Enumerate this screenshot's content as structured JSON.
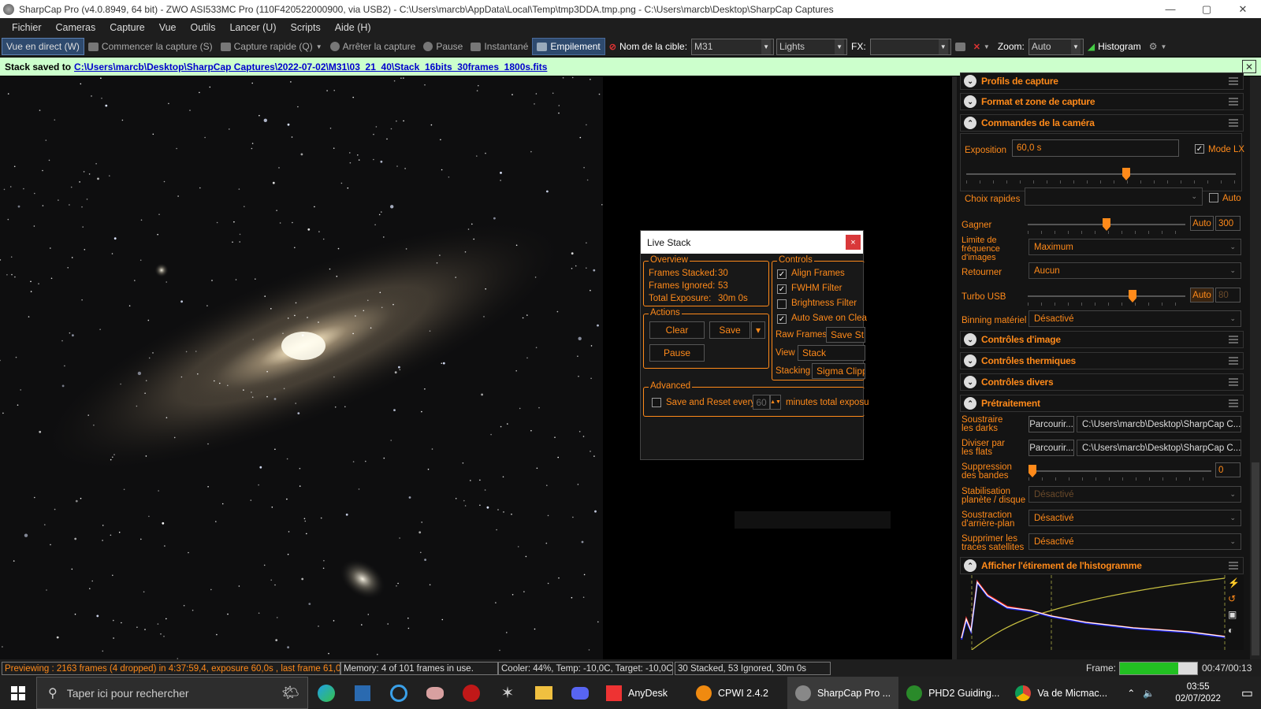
{
  "title_bar": {
    "title": "SharpCap Pro (v4.0.8949, 64 bit) - ZWO ASI533MC Pro (110F420522000900, via USB2) - C:\\Users\\marcb\\AppData\\Local\\Temp\\tmp3DDA.tmp.png - C:\\Users\\marcb\\Desktop\\SharpCap Captures",
    "minimize": "—",
    "maximize": "▢",
    "close": "✕"
  },
  "menu": [
    "Fichier",
    "Cameras",
    "Capture",
    "Vue",
    "Outils",
    "Lancer (U)",
    "Scripts",
    "Aide (H)"
  ],
  "toolbar": {
    "live_view": "Vue en direct (W)",
    "start_capture": "Commencer la capture (S)",
    "quick_capture": "Capture rapide (Q)",
    "stop_capture": "Arrêter la capture",
    "pause": "Pause",
    "snapshot": "Instantané",
    "stacking": "Empilement",
    "target_label": "Nom de la cible:",
    "target_value": "M31",
    "frame_type": "Lights",
    "fx_label": "FX:",
    "fx_value": "",
    "zoom_label": "Zoom:",
    "zoom_value": "Auto",
    "histogram": "Histogram"
  },
  "notification": {
    "prefix": "Stack saved to",
    "path": "C:\\Users\\marcb\\Desktop\\SharpCap Captures\\2022-07-02\\M31\\03_21_40\\Stack_16bits_30frames_1800s.fits",
    "close": "✕"
  },
  "live_stack": {
    "title": "Live Stack",
    "close": "×",
    "overview_title": "Overview",
    "frames_stacked_label": "Frames Stacked:",
    "frames_stacked_value": "30",
    "frames_ignored_label": "Frames Ignored:",
    "frames_ignored_value": "53",
    "total_exposure_label": "Total Exposure:",
    "total_exposure_value": "30m 0s",
    "controls_title": "Controls",
    "align_frames": "Align Frames",
    "fwhm_filter": "FWHM Filter",
    "brightness_filter": "Brightness Filter",
    "auto_save": "Auto Save on Clea",
    "raw_frames_label": "Raw Frames",
    "raw_frames_value": "Save St",
    "view_label": "View",
    "view_value": "Stack",
    "stacking_label": "Stacking",
    "stacking_value": "Sigma Clipp",
    "actions_title": "Actions",
    "clear": "Clear",
    "save": "Save",
    "save_arrow": "▾",
    "pause": "Pause",
    "advanced_title": "Advanced",
    "save_reset_label": "Save and Reset every",
    "save_reset_value": "60",
    "save_reset_suffix": "minutes total exposu"
  },
  "right_panel": {
    "sections": {
      "capture_profiles": "Profils de capture",
      "format": "Format et zone de capture",
      "camera_controls": "Commandes de la caméra",
      "image_controls": "Contrôles d'image",
      "thermal_controls": "Contrôles thermiques",
      "misc_controls": "Contrôles divers",
      "preprocessing": "Prétraitement",
      "histogram_stretch": "Afficher l'étirement de l'histogramme"
    },
    "exposure_label": "Exposition",
    "exposure_value": "60,0 s",
    "mode_lx": "Mode LX",
    "quick_choices_label": "Choix rapides",
    "quick_choices_auto": "Auto",
    "gain_label": "Gagner",
    "gain_auto": "Auto",
    "gain_value": "300",
    "frame_rate_label": "Limite de fréquence d'images",
    "frame_rate_value": "Maximum",
    "flip_label": "Retourner",
    "flip_value": "Aucun",
    "usb_label": "Turbo USB",
    "usb_auto": "Auto",
    "usb_value": "80",
    "binning_label": "Binning matériel",
    "binning_value": "Désactivé",
    "darks_label": "Soustraire les darks",
    "darks_browse": "Parcourir...",
    "darks_path": "C:\\Users\\marcb\\Desktop\\SharpCap C...",
    "flats_label": "Diviser par les flats",
    "flats_browse": "Parcourir...",
    "flats_path": "C:\\Users\\marcb\\Desktop\\SharpCap C...",
    "banding_label": "Suppression des bandes",
    "banding_value": "0",
    "stabilization_label": "Stabilisation planète / disque",
    "stabilization_value": "Désactivé",
    "background_label": "Soustraction d'arrière-plan",
    "background_value": "Désactivé",
    "satellite_label": "Supprimer les traces satellites",
    "satellite_value": "Désactivé"
  },
  "status": {
    "previewing": "Previewing : 2163 frames (4 dropped) in 4:37:59,4, exposure 60,0s , last frame 61,0",
    "memory": "Memory: 4 of 101 frames in use.",
    "cooler": "Cooler: 44%, Temp: -10,0C, Target: -10,0C",
    "stacked": "30 Stacked, 53 Ignored, 30m 0s",
    "frame_label": "Frame:",
    "frame_progress": 0.75,
    "time": "00:47/00:13"
  },
  "taskbar": {
    "search_placeholder": "Taper ici pour rechercher",
    "apps": [
      "AnyDesk",
      "CPWI 2.4.2",
      "SharpCap Pro ...",
      "PHD2 Guiding...",
      "Va de Micmac..."
    ],
    "clock_time": "03:55",
    "clock_date": "02/07/2022"
  },
  "colors": {
    "accent": "#ff8a1a",
    "notification_bg": "#ccffcc",
    "progress_green": "#22c022"
  }
}
